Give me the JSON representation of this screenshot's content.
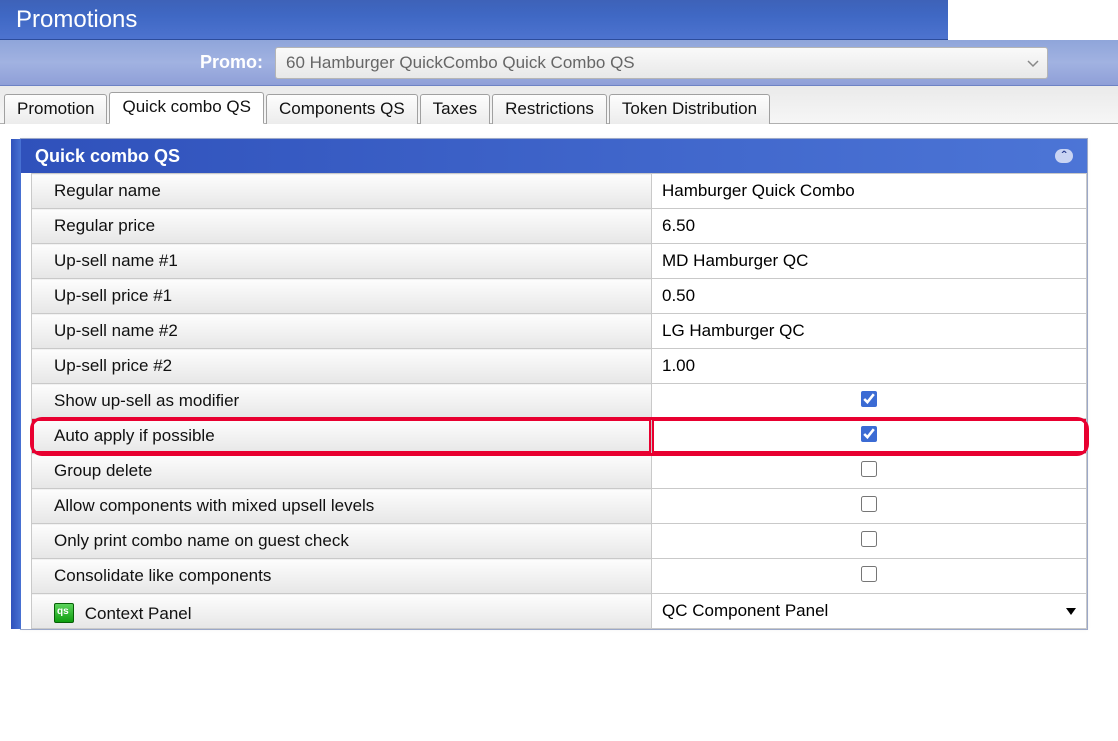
{
  "header": {
    "title": "Promotions"
  },
  "promo": {
    "label": "Promo:",
    "value": "60 Hamburger QuickCombo Quick Combo QS"
  },
  "tabs": [
    {
      "label": "Promotion",
      "active": false
    },
    {
      "label": "Quick combo QS",
      "active": true
    },
    {
      "label": "Components QS",
      "active": false
    },
    {
      "label": "Taxes",
      "active": false
    },
    {
      "label": "Restrictions",
      "active": false
    },
    {
      "label": "Token Distribution",
      "active": false
    }
  ],
  "section": {
    "title": "Quick combo QS"
  },
  "rows": {
    "regularName": {
      "label": "Regular name",
      "value": "Hamburger Quick Combo",
      "type": "text"
    },
    "regularPrice": {
      "label": "Regular price",
      "value": "6.50",
      "type": "text"
    },
    "upsellName1": {
      "label": "Up-sell name #1",
      "value": "MD Hamburger QC",
      "type": "text"
    },
    "upsellPrice1": {
      "label": "Up-sell price #1",
      "value": "0.50",
      "type": "text"
    },
    "upsellName2": {
      "label": "Up-sell name #2",
      "value": "LG Hamburger QC",
      "type": "text"
    },
    "upsellPrice2": {
      "label": "Up-sell price #2",
      "value": "1.00",
      "type": "text"
    },
    "showUpsellMod": {
      "label": "Show up-sell as modifier",
      "checked": true,
      "type": "check"
    },
    "autoApply": {
      "label": "Auto apply if possible",
      "checked": true,
      "type": "check",
      "highlight": true
    },
    "groupDelete": {
      "label": "Group delete",
      "checked": false,
      "type": "check"
    },
    "allowMixed": {
      "label": "Allow components with mixed upsell levels",
      "checked": false,
      "type": "check"
    },
    "onlyPrintCombo": {
      "label": "Only print combo name on guest check",
      "checked": false,
      "type": "check"
    },
    "consolidate": {
      "label": "Consolidate like components",
      "checked": false,
      "type": "check"
    },
    "contextPanel": {
      "label": "Context Panel",
      "value": "QC Component Panel",
      "type": "dropdown"
    }
  }
}
